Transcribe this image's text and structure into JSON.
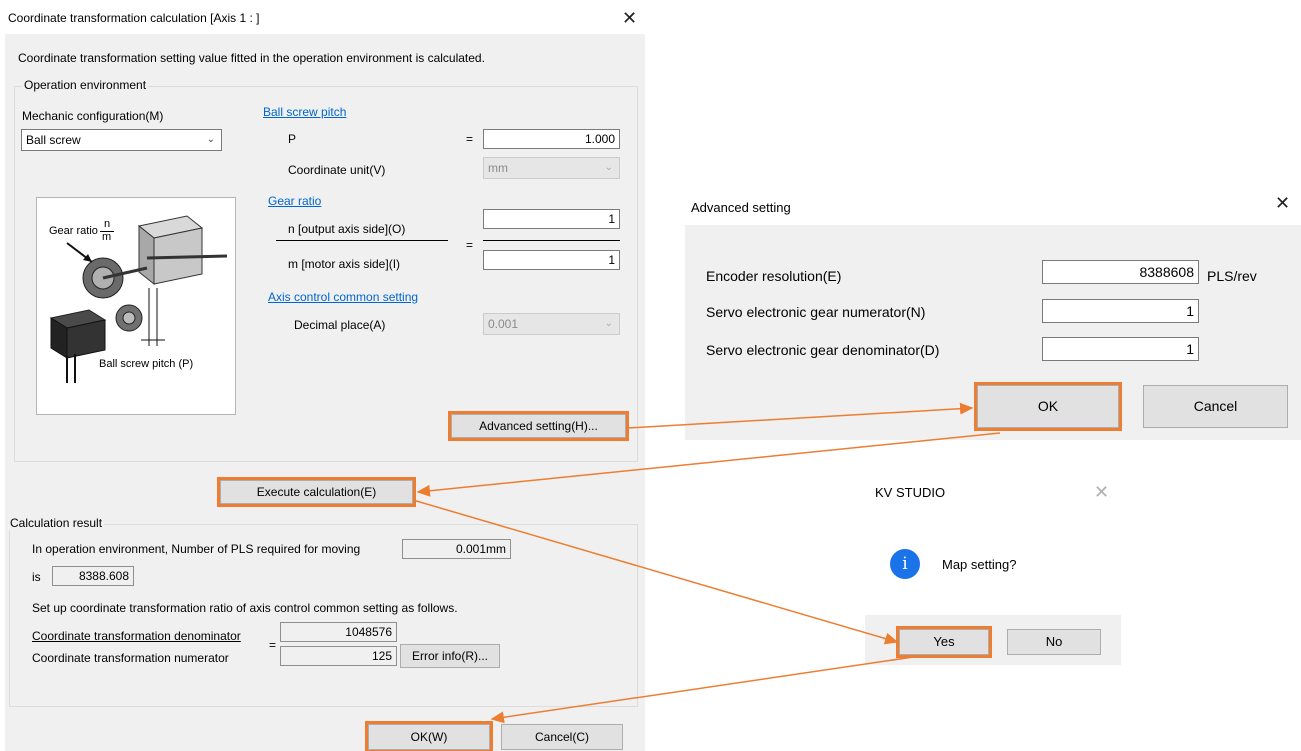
{
  "main_dialog": {
    "title": "Coordinate transformation calculation [Axis 1 : ]",
    "description": "Coordinate transformation setting value fitted in the operation environment is calculated.",
    "operation_environment": {
      "group_label": "Operation environment",
      "mechanic_label": "Mechanic configuration(M)",
      "mechanic_value": "Ball screw",
      "ball_screw_pitch_link": "Ball screw pitch",
      "p_label": "P",
      "equals": "=",
      "p_value": "1.000",
      "coord_unit_label": "Coordinate unit(V)",
      "coord_unit_value": "mm",
      "gear_ratio_link": "Gear ratio",
      "n_label": "n [output axis side](O)",
      "n_value": "1",
      "m_label": "m [motor axis side](I)",
      "m_value": "1",
      "axis_common_link": "Axis control common setting",
      "decimal_label": "Decimal place(A)",
      "decimal_value": "0.001",
      "advanced_button": "Advanced setting(H)...",
      "diagram": {
        "gear_ratio_text": "Gear ratio",
        "n": "n",
        "m": "m",
        "pitch_text": "Ball screw pitch (P)"
      }
    },
    "execute_button": "Execute calculation(E)",
    "calculation_result": {
      "group_label": "Calculation result",
      "line1": "In operation environment, Number of PLS required for moving",
      "moving_value": "0.001mm",
      "is_label": "is",
      "pls_value": "8388.608",
      "setup_text": "Set up coordinate transformation ratio of axis control common setting as follows.",
      "denominator_label": "Coordinate transformation denominator",
      "numerator_label": "Coordinate transformation numerator",
      "equals": "=",
      "denominator_value": "1048576",
      "numerator_value": "125",
      "error_button": "Error info(R)..."
    },
    "ok_button": "OK(W)",
    "cancel_button": "Cancel(C)"
  },
  "advanced_dialog": {
    "title": "Advanced setting",
    "encoder_label": "Encoder resolution(E)",
    "encoder_value": "8388608",
    "encoder_unit": "PLS/rev",
    "numerator_label": "Servo electronic gear numerator(N)",
    "numerator_value": "1",
    "denominator_label": "Servo electronic gear denominator(D)",
    "denominator_value": "1",
    "ok_button": "OK",
    "cancel_button": "Cancel"
  },
  "kv_dialog": {
    "title": "KV STUDIO",
    "message": "Map setting?",
    "icon_glyph": "i",
    "yes_button": "Yes",
    "no_button": "No"
  },
  "icons": {
    "close": "✕",
    "chevron": "⌄"
  },
  "colors": {
    "highlight": "#ed7d31",
    "link": "#0066cc",
    "info_icon": "#1a73e8",
    "dialog_bg": "#f0f0f0"
  }
}
